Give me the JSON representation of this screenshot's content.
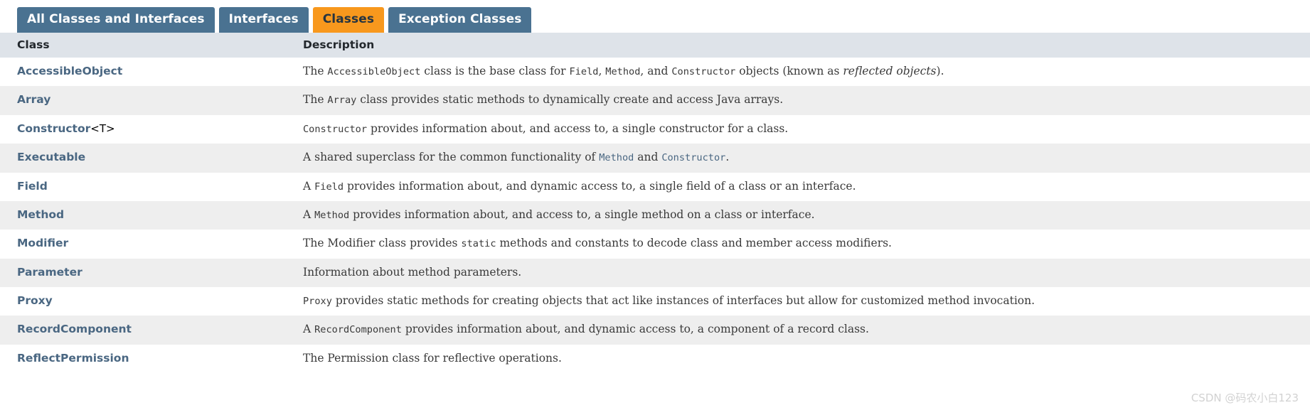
{
  "tabs": [
    {
      "label": "All Classes and Interfaces",
      "active": false
    },
    {
      "label": "Interfaces",
      "active": false
    },
    {
      "label": "Classes",
      "active": true
    },
    {
      "label": "Exception Classes",
      "active": false
    }
  ],
  "table": {
    "headers": {
      "class": "Class",
      "description": "Description"
    },
    "rows": [
      {
        "name": "AccessibleObject",
        "generic": "",
        "desc_parts": [
          {
            "t": "The ",
            "s": "plain"
          },
          {
            "t": "AccessibleObject",
            "s": "code"
          },
          {
            "t": " class is the base class for ",
            "s": "plain"
          },
          {
            "t": "Field",
            "s": "code"
          },
          {
            "t": ", ",
            "s": "plain"
          },
          {
            "t": "Method",
            "s": "code"
          },
          {
            "t": ", and ",
            "s": "plain"
          },
          {
            "t": "Constructor",
            "s": "code"
          },
          {
            "t": " objects (known as ",
            "s": "plain"
          },
          {
            "t": "reflected objects",
            "s": "italic"
          },
          {
            "t": ").",
            "s": "plain"
          }
        ]
      },
      {
        "name": "Array",
        "generic": "",
        "desc_parts": [
          {
            "t": "The ",
            "s": "plain"
          },
          {
            "t": "Array",
            "s": "code"
          },
          {
            "t": " class provides static methods to dynamically create and access Java arrays.",
            "s": "plain"
          }
        ]
      },
      {
        "name": "Constructor",
        "generic": "<T>",
        "desc_parts": [
          {
            "t": "Constructor",
            "s": "code"
          },
          {
            "t": " provides information about, and access to, a single constructor for a class.",
            "s": "plain"
          }
        ]
      },
      {
        "name": "Executable",
        "generic": "",
        "desc_parts": [
          {
            "t": "A shared superclass for the common functionality of ",
            "s": "plain"
          },
          {
            "t": "Method",
            "s": "link"
          },
          {
            "t": " and ",
            "s": "plain"
          },
          {
            "t": "Constructor",
            "s": "link"
          },
          {
            "t": ".",
            "s": "plain"
          }
        ]
      },
      {
        "name": "Field",
        "generic": "",
        "desc_parts": [
          {
            "t": "A ",
            "s": "plain"
          },
          {
            "t": "Field",
            "s": "code"
          },
          {
            "t": " provides information about, and dynamic access to, a single field of a class or an interface.",
            "s": "plain"
          }
        ]
      },
      {
        "name": "Method",
        "generic": "",
        "desc_parts": [
          {
            "t": "A ",
            "s": "plain"
          },
          {
            "t": "Method",
            "s": "code"
          },
          {
            "t": " provides information about, and access to, a single method on a class or interface.",
            "s": "plain"
          }
        ]
      },
      {
        "name": "Modifier",
        "generic": "",
        "desc_parts": [
          {
            "t": "The Modifier class provides ",
            "s": "plain"
          },
          {
            "t": "static",
            "s": "code"
          },
          {
            "t": " methods and constants to decode class and member access modifiers.",
            "s": "plain"
          }
        ]
      },
      {
        "name": "Parameter",
        "generic": "",
        "desc_parts": [
          {
            "t": "Information about method parameters.",
            "s": "plain"
          }
        ]
      },
      {
        "name": "Proxy",
        "generic": "",
        "desc_parts": [
          {
            "t": "Proxy",
            "s": "code"
          },
          {
            "t": " provides static methods for creating objects that act like instances of interfaces but allow for customized method invocation.",
            "s": "plain"
          }
        ]
      },
      {
        "name": "RecordComponent",
        "generic": "",
        "desc_parts": [
          {
            "t": "A ",
            "s": "plain"
          },
          {
            "t": "RecordComponent",
            "s": "code"
          },
          {
            "t": " provides information about, and dynamic access to, a component of a record class.",
            "s": "plain"
          }
        ]
      },
      {
        "name": "ReflectPermission",
        "generic": "",
        "desc_parts": [
          {
            "t": "The Permission class for reflective operations.",
            "s": "plain"
          }
        ]
      }
    ]
  },
  "watermark": "CSDN @码农小白123",
  "colors": {
    "tab_bg": "#4a7291",
    "tab_active_bg": "#f8981d",
    "header_bg": "#dee3e9",
    "row_even_bg": "#eeeeee",
    "link": "#4a6782"
  }
}
